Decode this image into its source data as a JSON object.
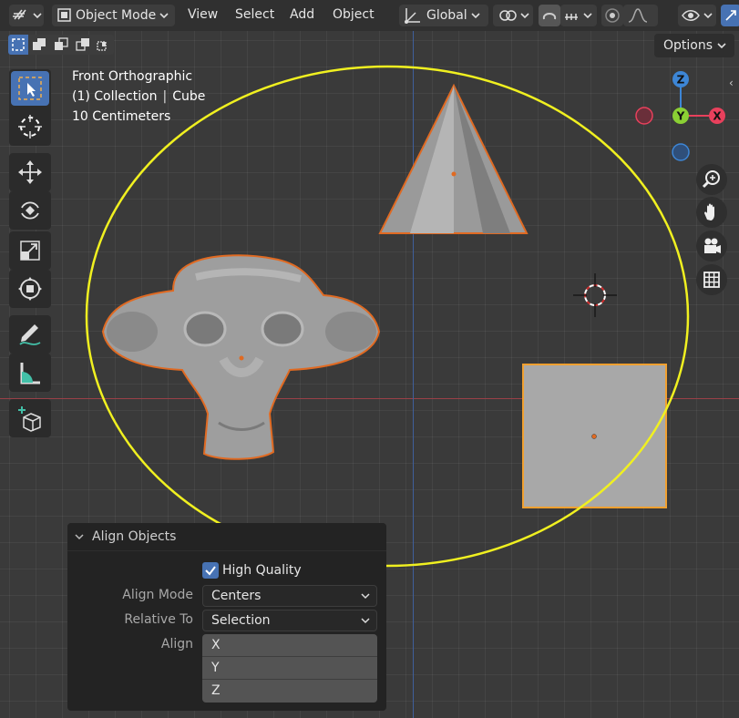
{
  "header": {
    "mode_label": "Object Mode",
    "menus": [
      "View",
      "Select",
      "Add",
      "Object"
    ],
    "orientation_label": "Global",
    "options_label": "Options"
  },
  "viewport": {
    "view_name": "Front Orthographic",
    "collection_label": "(1) Collection",
    "active_object": "Cube",
    "scale_label": "10 Centimeters"
  },
  "gizmo": {
    "z": "Z",
    "y": "Y",
    "x": "X",
    "colors": {
      "x": "#e8405c",
      "y": "#8bd034",
      "z": "#3d86d6"
    }
  },
  "panel": {
    "title": "Align Objects",
    "high_quality_label": "High Quality",
    "high_quality_checked": true,
    "align_mode_label": "Align Mode",
    "align_mode_value": "Centers",
    "relative_to_label": "Relative To",
    "relative_to_value": "Selection",
    "align_label": "Align",
    "align_options": [
      "X",
      "Y",
      "Z"
    ]
  },
  "colors": {
    "accent": "#4772b3",
    "selection_outline": "#e06a22",
    "annotation_yellow": "#f0f020",
    "arrow_orange": "#f0841c"
  }
}
